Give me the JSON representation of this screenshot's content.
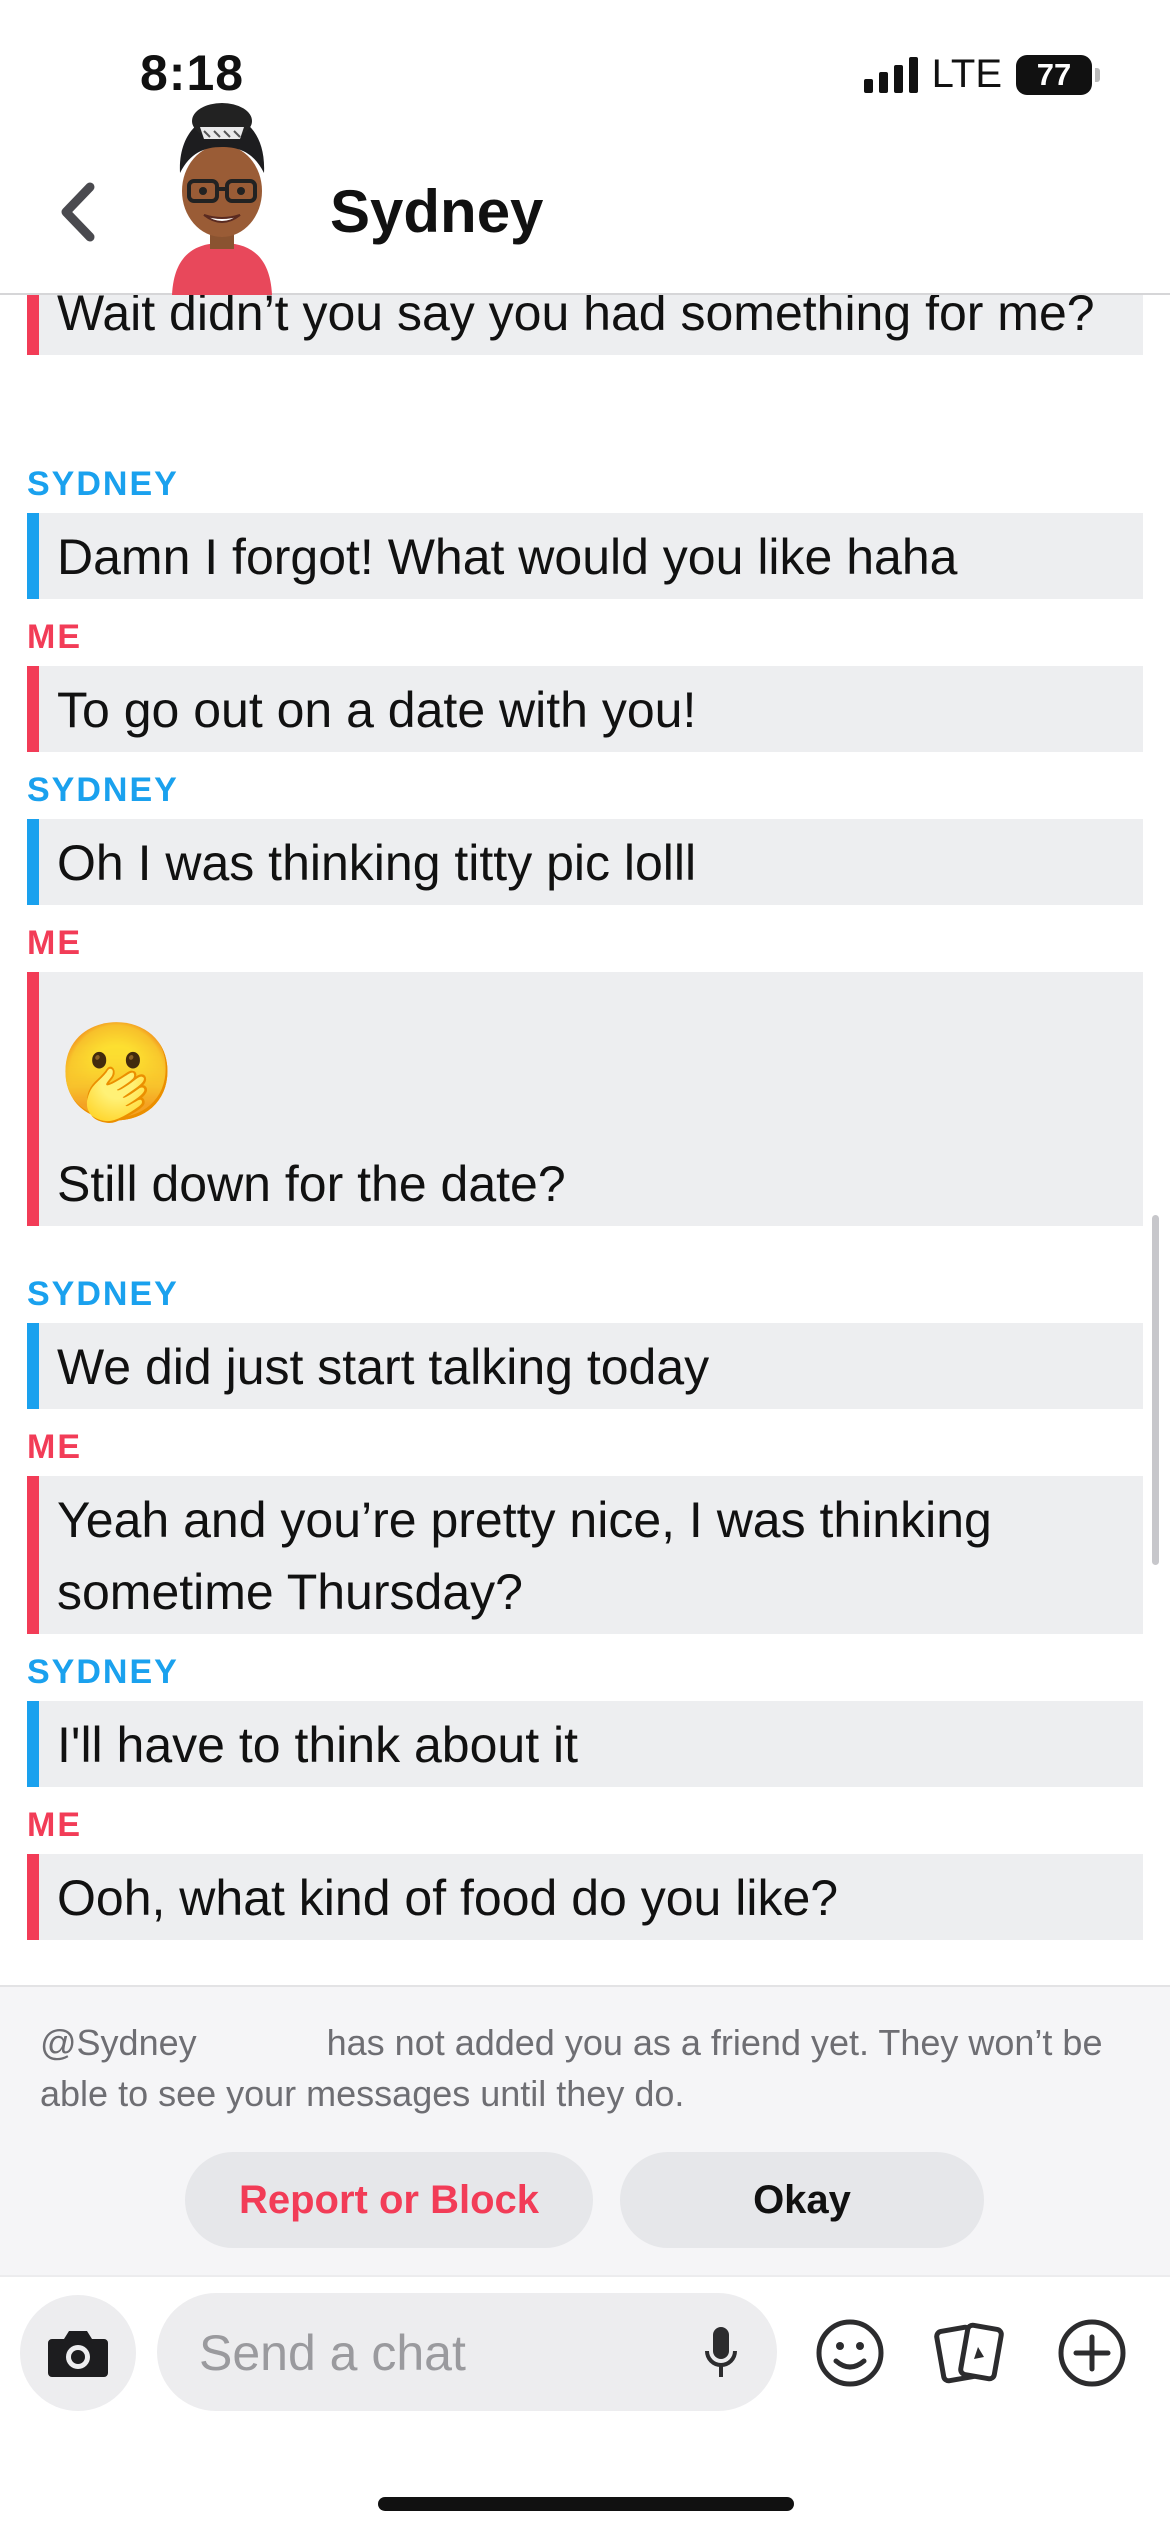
{
  "status_bar": {
    "time": "8:18",
    "network": "LTE",
    "battery": "77"
  },
  "header": {
    "contact_name": "Sydney",
    "back_icon": "chevron-left-icon",
    "avatar_icon": "bitmoji-avatar"
  },
  "messages": [
    {
      "sender": "",
      "from": "me",
      "text": "Wait didn’t you say you had something for me?"
    },
    {
      "sender": "SYDNEY",
      "from": "them",
      "text": "Damn I forgot! What would you like haha"
    },
    {
      "sender": "ME",
      "from": "me",
      "text": "To go out on a date with you!"
    },
    {
      "sender": "SYDNEY",
      "from": "them",
      "text": "Oh I was thinking titty pic lolll"
    },
    {
      "sender": "ME",
      "from": "me",
      "emoji": "🫢",
      "text": "Still down for the date?"
    },
    {
      "sender": "SYDNEY",
      "from": "them",
      "text": "We did just start talking today"
    },
    {
      "sender": "ME",
      "from": "me",
      "text": "Yeah and you’re pretty nice, I was thinking sometime Thursday?"
    },
    {
      "sender": "SYDNEY",
      "from": "them",
      "text": "I'll have to think about it"
    },
    {
      "sender": "ME",
      "from": "me",
      "text": "Ooh, what kind of food do you like?"
    }
  ],
  "notice": {
    "handle": "@Sydney",
    "text": "has not added you as a friend yet. They won’t be able to see your messages until they do.",
    "report_label": "Report or Block",
    "okay_label": "Okay"
  },
  "composer": {
    "placeholder": "Send a chat",
    "icons": [
      "camera-icon",
      "microphone-icon",
      "smiley-icon",
      "cards-icon",
      "plus-icon"
    ]
  },
  "colors": {
    "me": "#f23c57",
    "them": "#1aa1ee",
    "bubble": "#edeef0"
  }
}
